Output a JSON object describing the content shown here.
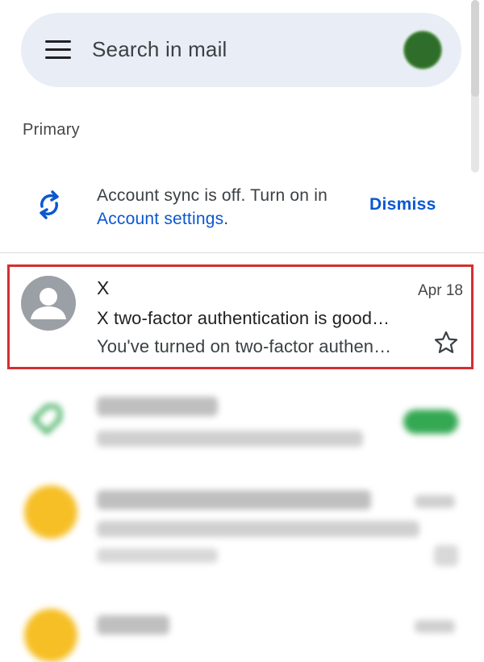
{
  "search": {
    "placeholder": "Search in mail"
  },
  "section": {
    "label": "Primary"
  },
  "sync_banner": {
    "text_before": "Account sync is off. Turn on in ",
    "link_text": "Account settings",
    "text_after": ".",
    "dismiss_label": "Dismiss"
  },
  "highlighted_email": {
    "sender": "X",
    "date": "Apr 18",
    "subject": "X two-factor authentication is good…",
    "snippet": "You've turned on two-factor authen…"
  },
  "colors": {
    "accent": "#0b57d0",
    "highlight_border": "#d32f2f",
    "searchbar_bg": "#e9eef6",
    "avatar_grey": "#9aa0a6",
    "promo_green": "#34a853",
    "yellow_avatar": "#f6bf26"
  },
  "icons": {
    "menu": "hamburger-menu-icon",
    "sync": "sync-icon",
    "star": "star-outline-icon",
    "avatar": "person-avatar-icon",
    "promotions": "tag-icon"
  }
}
